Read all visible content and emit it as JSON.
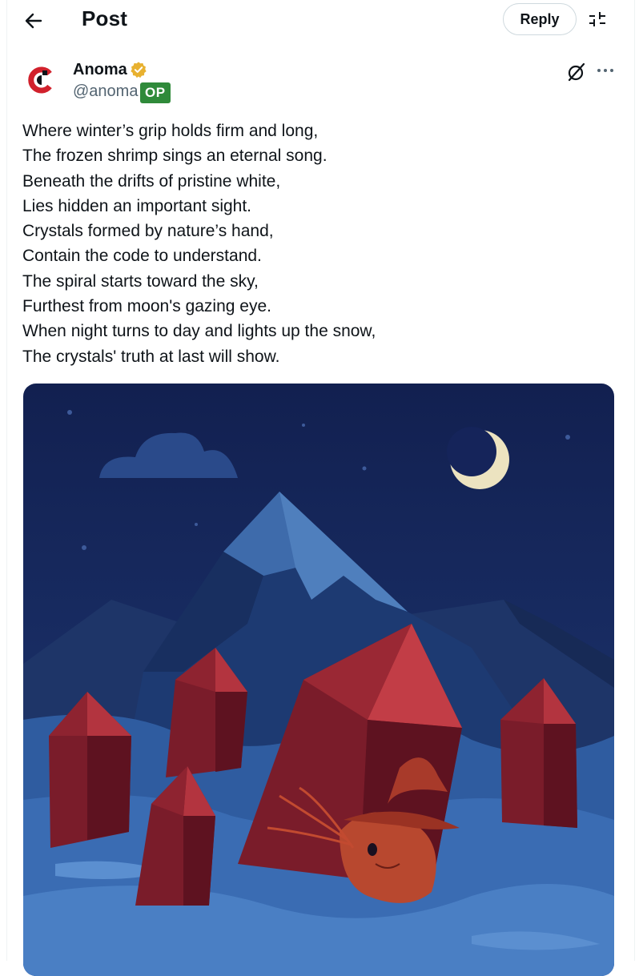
{
  "header": {
    "title": "Post",
    "reply_label": "Reply"
  },
  "author": {
    "name": "Anoma",
    "handle": "@anoma",
    "op_badge": "OP",
    "verified": true,
    "badge_color": "#e8b130",
    "avatar_accent": "#d1212c"
  },
  "post": {
    "lines": [
      "Where winter’s grip holds firm and long,",
      "The frozen shrimp sings an eternal song.",
      "Beneath the drifts of pristine white,",
      "Lies hidden an important sight.",
      "Crystals formed by nature’s hand,",
      "Contain the code to understand.",
      "The spiral starts toward the sky,",
      "Furthest from moon's gazing eye.",
      "When night turns to day and lights up the snow,",
      "The crystals' truth at last will show."
    ]
  },
  "icons": {
    "back": "arrow-left-icon",
    "filter": "sliders-icon",
    "grok": "grok-icon",
    "more": "more-horizontal-icon",
    "verified": "verified-badge-icon"
  }
}
